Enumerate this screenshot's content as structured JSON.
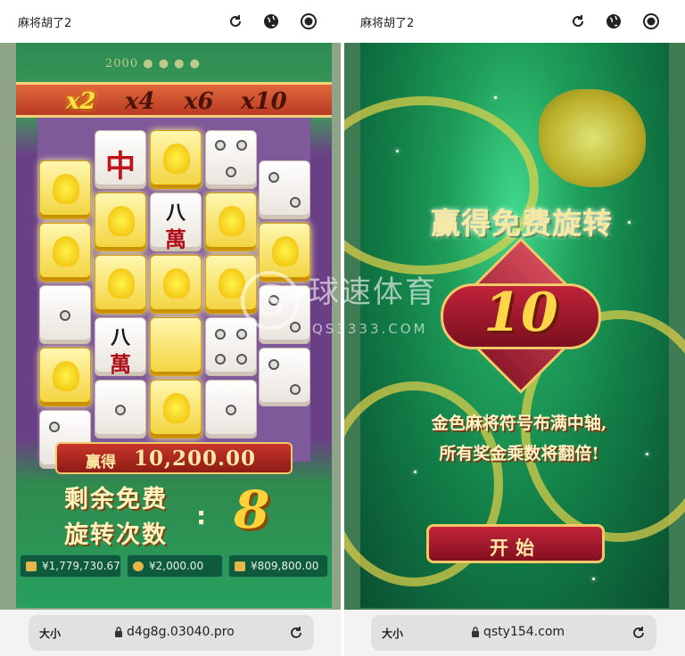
{
  "left": {
    "tab_title": "麻将胡了2",
    "multipliers": [
      "x2",
      "x4",
      "x6",
      "x10"
    ],
    "active_multiplier": "x2",
    "win_label": "赢得",
    "win_amount": "10,200.00",
    "free_spins_line1": "剩余免费",
    "free_spins_line2": "旋转次数",
    "free_spins_colon": ":",
    "free_spins_count": "8",
    "stats": [
      "¥1,779,730.67",
      "¥2,000.00",
      "¥809,800.00"
    ],
    "url_size_label": "大小",
    "url": "d4g8g.03040.pro",
    "tile_chars": {
      "zhong": "中",
      "ba": "八",
      "wan": "萬"
    }
  },
  "right": {
    "tab_title": "麻将胡了2",
    "title": "赢得免费旋转",
    "count": "10",
    "desc_line1": "金色麻将符号布满中轴,",
    "desc_line2": "所有奖金乘数将翻倍!",
    "start_label": "开始",
    "url_size_label": "大小",
    "url": "qsty154.com"
  },
  "watermark": {
    "cn": "球速体育",
    "en": "QS3333.COM",
    "s": "S"
  },
  "colors": {
    "gold": "#ffd23a",
    "red": "#c3243a",
    "green": "#1f9e5a"
  }
}
